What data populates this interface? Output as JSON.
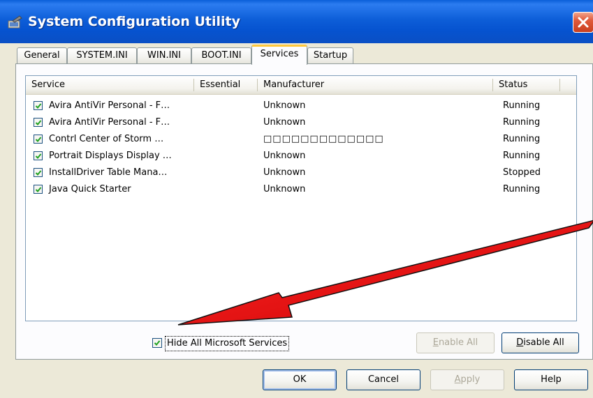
{
  "window": {
    "title": "System Configuration Utility",
    "app_icon": "msconfig-icon",
    "close_icon": "close-icon"
  },
  "tabs": [
    {
      "label": "General"
    },
    {
      "label": "SYSTEM.INI"
    },
    {
      "label": "WIN.INI"
    },
    {
      "label": "BOOT.INI"
    },
    {
      "label": "Services",
      "active": true
    },
    {
      "label": "Startup"
    }
  ],
  "services": {
    "columns": [
      "Service",
      "Essential",
      "Manufacturer",
      "Status"
    ],
    "rows": [
      {
        "checked": true,
        "service": "Avira AntiVir Personal - F…",
        "essential": "",
        "manufacturer": "Unknown",
        "status": "Running"
      },
      {
        "checked": true,
        "service": "Avira AntiVir Personal - F…",
        "essential": "",
        "manufacturer": "Unknown",
        "status": "Running"
      },
      {
        "checked": true,
        "service": "Contrl Center of Storm …",
        "essential": "",
        "manufacturer": "□□□□□□□□□□□□□",
        "status": "Running"
      },
      {
        "checked": true,
        "service": "Portrait Displays Display …",
        "essential": "",
        "manufacturer": "Unknown",
        "status": "Running"
      },
      {
        "checked": true,
        "service": "InstallDriver Table Mana…",
        "essential": "",
        "manufacturer": "Unknown",
        "status": "Stopped"
      },
      {
        "checked": true,
        "service": "Java Quick Starter",
        "essential": "",
        "manufacturer": "Unknown",
        "status": "Running"
      }
    ]
  },
  "hide_ms": {
    "label": "Hide All Microsoft Services",
    "checked": true
  },
  "buttons": {
    "enable_all": {
      "first": "E",
      "rest": "nable All"
    },
    "disable_all": {
      "first": "D",
      "rest": "isable All"
    },
    "ok": "OK",
    "cancel": "Cancel",
    "apply": {
      "first": "A",
      "rest": "pply"
    },
    "help": "Help"
  },
  "annotation": {
    "color": "#e00000",
    "icon": "arrow-annotation"
  }
}
